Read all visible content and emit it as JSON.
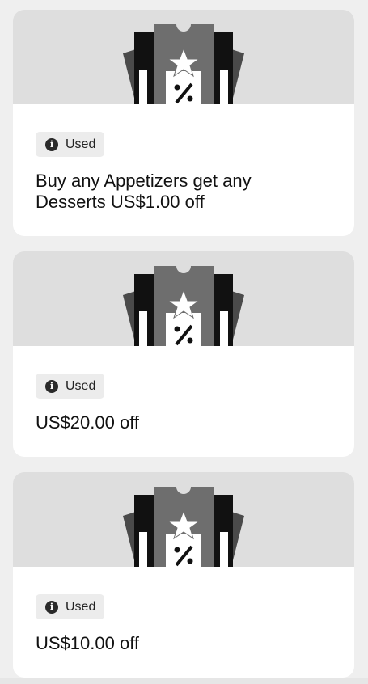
{
  "coupons": [
    {
      "icon": "coupon-tickets-illustration",
      "badge_icon": "info-icon",
      "badge_glyph": "i",
      "status": "Used",
      "title": "Buy any Appetizers get any Desserts US$1.00 off"
    },
    {
      "icon": "coupon-tickets-illustration",
      "badge_icon": "info-icon",
      "badge_glyph": "i",
      "status": "Used",
      "title": "US$20.00 off"
    },
    {
      "icon": "coupon-tickets-illustration",
      "badge_icon": "info-icon",
      "badge_glyph": "i",
      "status": "Used",
      "title": "US$10.00 off"
    }
  ],
  "colors": {
    "page_bg": "#efefef",
    "card_bg": "#ffffff",
    "banner_bg": "#dedede",
    "badge_bg": "#ececec",
    "badge_icon_bg": "#2a2a2a"
  }
}
